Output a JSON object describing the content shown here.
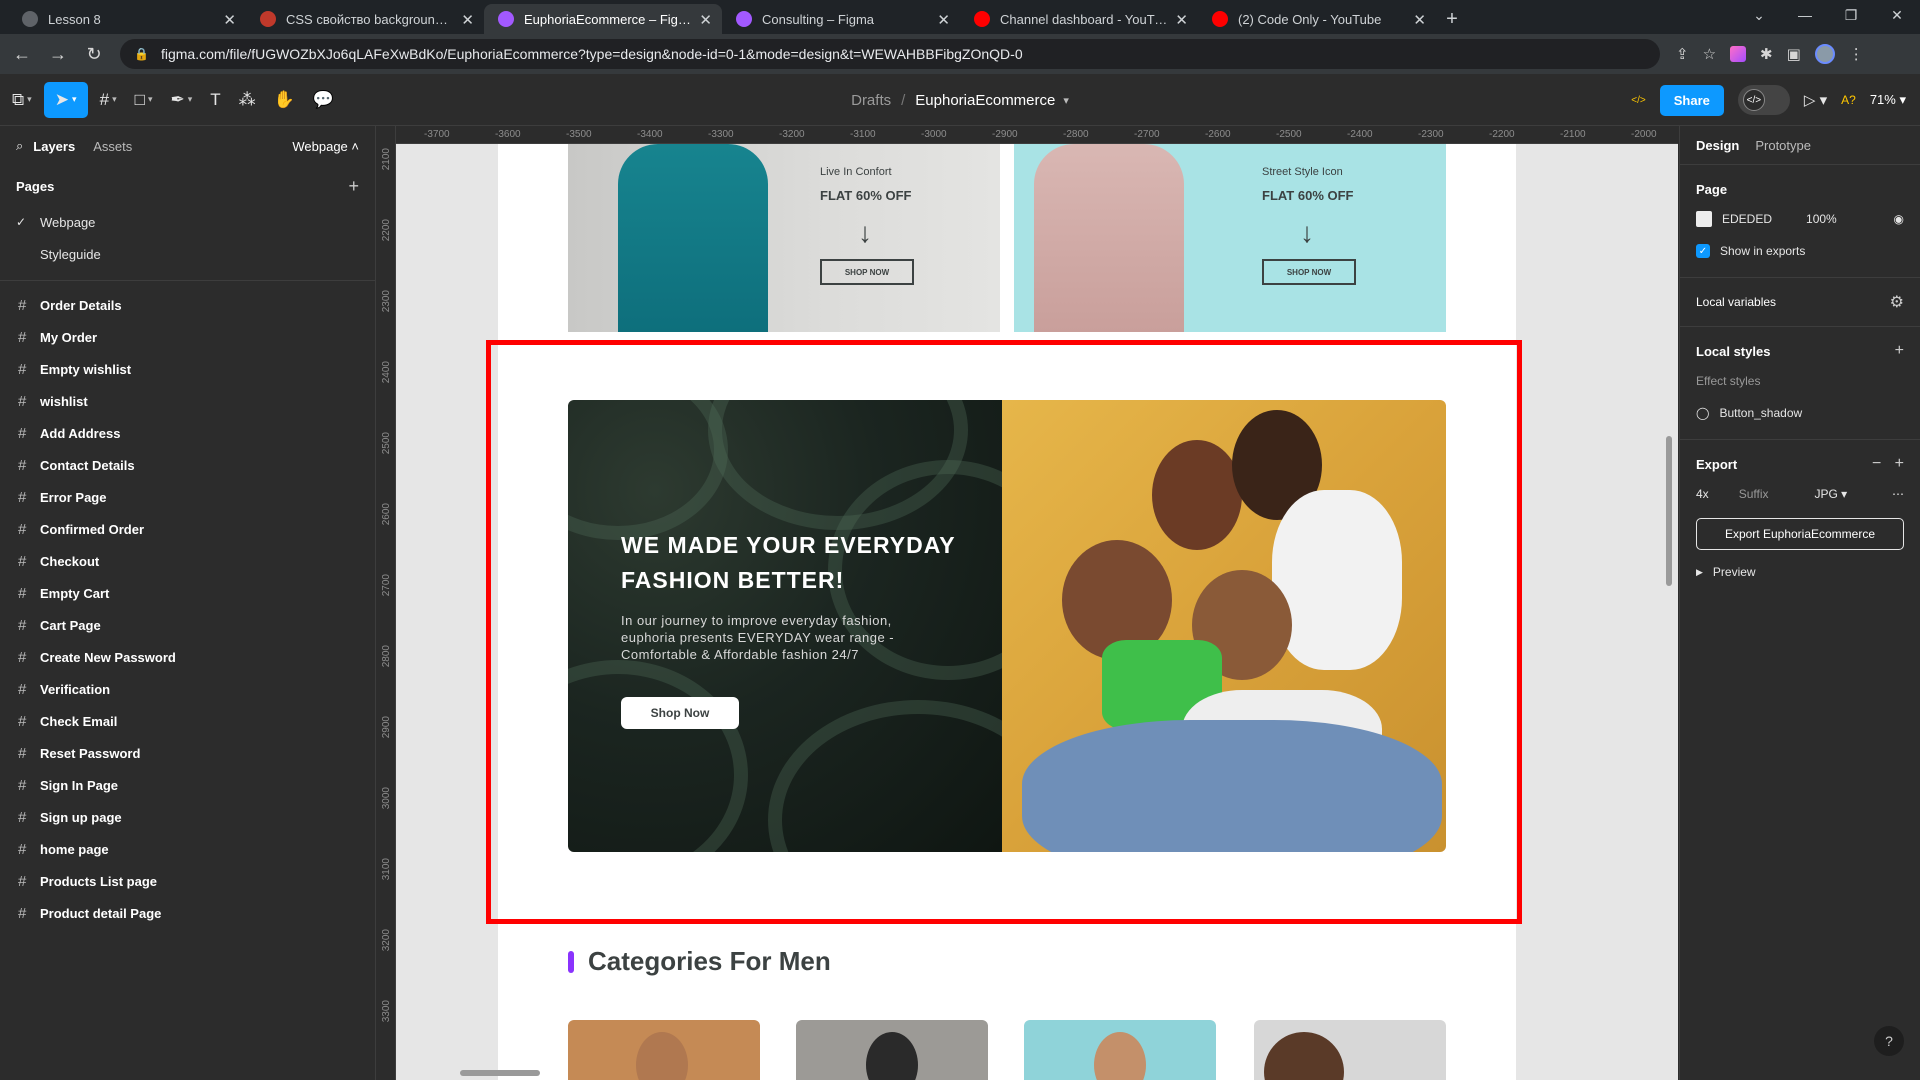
{
  "browser": {
    "tabs": [
      {
        "label": "Lesson 8",
        "fav_color": "#5f6368",
        "active": false
      },
      {
        "label": "CSS свойство background. Фон",
        "fav_color": "#c0392b",
        "active": false
      },
      {
        "label": "EuphoriaEcommerce – Figma",
        "fav_color": "#a259ff",
        "active": true
      },
      {
        "label": "Consulting – Figma",
        "fav_color": "#a259ff",
        "active": false
      },
      {
        "label": "Channel dashboard - YouTube S",
        "fav_color": "#ff0000",
        "active": false
      },
      {
        "label": "(2) Code Only - YouTube",
        "fav_color": "#ff0000",
        "active": false
      }
    ],
    "url": "figma.com/file/fUGWOZbXJo6qLAFeXwBdKo/EuphoriaEcommerce?type=design&node-id=0-1&mode=design&t=WEWAHBBFibgZOnQD-0"
  },
  "toolbar": {
    "breadcrumb_parent": "Drafts",
    "breadcrumb_file": "EuphoriaEcommerce",
    "dev_label": "</>",
    "share_label": "Share",
    "ai_label": "A?",
    "zoom_label": "71%"
  },
  "left_panel": {
    "tab_layers": "Layers",
    "tab_assets": "Assets",
    "page_selector": "Webpage",
    "pages_heading": "Pages",
    "pages": [
      "Webpage",
      "Styleguide"
    ],
    "frames": [
      "Order Details",
      "My Order",
      "Empty wishlist",
      "wishlist",
      "Add Address",
      "Contact Details",
      "Error Page",
      "Confirmed Order",
      "Checkout",
      "Empty Cart",
      "Cart Page",
      "Create New Password",
      "Verification",
      "Check Email",
      "Reset Password",
      "Sign In Page",
      "Sign up page",
      "home page",
      "Products List page",
      "Product detail Page"
    ]
  },
  "rulers": {
    "top": [
      "-3700",
      "-3600",
      "-3500",
      "-3400",
      "-3300",
      "-3200",
      "-3100",
      "-3000",
      "-2900",
      "-2800",
      "-2700",
      "-2600",
      "-2500",
      "-2400",
      "-2300",
      "-2200",
      "-2100",
      "-2000"
    ],
    "left": [
      "2100",
      "2200",
      "2300",
      "2400",
      "2500",
      "2600",
      "2700",
      "2800",
      "2900",
      "3000",
      "3100",
      "3200",
      "3300"
    ]
  },
  "webpage": {
    "promo1": {
      "subtitle": "Live In Confort",
      "title": "FLAT 60% OFF",
      "button": "SHOP NOW"
    },
    "promo2": {
      "subtitle": "Street Style Icon",
      "title": "FLAT 60% OFF",
      "button": "SHOP NOW"
    },
    "banner": {
      "heading": "WE MADE YOUR EVERYDAY FASHION BETTER!",
      "body": "In our journey to improve everyday fashion, euphoria presents EVERYDAY wear range - Comfortable & Affordable fashion 24/7",
      "button": "Shop Now"
    },
    "categories_heading": "Categories For Men",
    "accent_color": "#8a33fd"
  },
  "right_panel": {
    "tab_design": "Design",
    "tab_prototype": "Prototype",
    "page_heading": "Page",
    "page_color": "EDEDED",
    "page_opacity": "100%",
    "show_in_exports": "Show in exports",
    "local_variables": "Local variables",
    "local_styles": "Local styles",
    "effect_styles": "Effect styles",
    "effect_style_item": "Button_shadow",
    "export_heading": "Export",
    "export_scale": "4x",
    "export_suffix_placeholder": "Suffix",
    "export_format": "JPG",
    "export_button": "Export EuphoriaEcommerce",
    "preview": "Preview"
  }
}
